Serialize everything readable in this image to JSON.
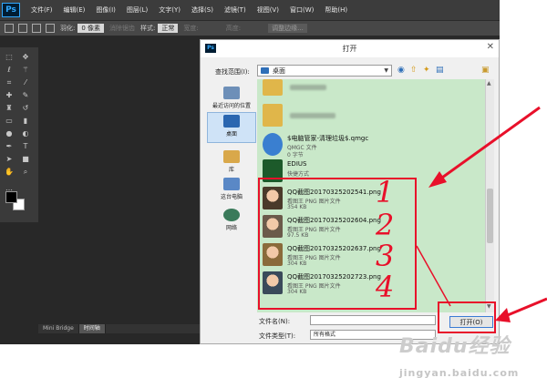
{
  "app": {
    "logo": "Ps",
    "menu": [
      "文件(F)",
      "编辑(E)",
      "图像(I)",
      "图层(L)",
      "文字(Y)",
      "选择(S)",
      "滤镜(T)",
      "视图(V)",
      "窗口(W)",
      "帮助(H)"
    ],
    "options": {
      "feather_label": "羽化:",
      "feather_value": "0 像素",
      "antialias": "消除锯齿",
      "style_label": "样式:",
      "style_value": "正常",
      "width_label": "宽度:",
      "height_label": "高度:",
      "refine": "调整边缘..."
    },
    "bottom_tabs": [
      "Mini Bridge",
      "时间轴"
    ]
  },
  "dialog": {
    "title": "打开",
    "lookin_label": "查找范围(I):",
    "lookin_value": "桌面",
    "places": [
      {
        "label": "最近访问的位置",
        "icon": "recent-places-icon"
      },
      {
        "label": "桌面",
        "icon": "desktop-icon",
        "active": true
      },
      {
        "label": "库",
        "icon": "library-icon"
      },
      {
        "label": "这台电脑",
        "icon": "computer-icon"
      },
      {
        "label": "网络",
        "icon": "network-icon"
      }
    ],
    "files": [
      {
        "name": "$电脑管家-清理垃圾$.qmgc",
        "type": "QMGC 文件",
        "size": "0 字节",
        "icon": "qmgc-file-icon"
      },
      {
        "name": "EDIUS",
        "type": "快捷方式",
        "size": "",
        "icon": "edius-shortcut-icon"
      },
      {
        "name": "QQ截图20170325202541.png",
        "type": "看图王 PNG 图片文件",
        "size": "354 KB",
        "icon": "image-thumbnail"
      },
      {
        "name": "QQ截图20170325202604.png",
        "type": "看图王 PNG 图片文件",
        "size": "97.5 KB",
        "icon": "image-thumbnail"
      },
      {
        "name": "QQ截图20170325202637.png",
        "type": "看图王 PNG 图片文件",
        "size": "304 KB",
        "icon": "image-thumbnail"
      },
      {
        "name": "QQ截图20170325202723.png",
        "type": "看图王 PNG 图片文件",
        "size": "304 KB",
        "icon": "image-thumbnail"
      }
    ],
    "filename_label": "文件名(N):",
    "filename_value": "",
    "filetype_label": "文件类型(T):",
    "filetype_value": "所有格式",
    "open_button": "打开(O)"
  },
  "annotations": {
    "numbers": [
      "1",
      "2",
      "3",
      "4"
    ],
    "color": "#e8102a"
  },
  "watermark": {
    "text": "Baidu经验",
    "sub": "jingyan.baidu.com"
  }
}
